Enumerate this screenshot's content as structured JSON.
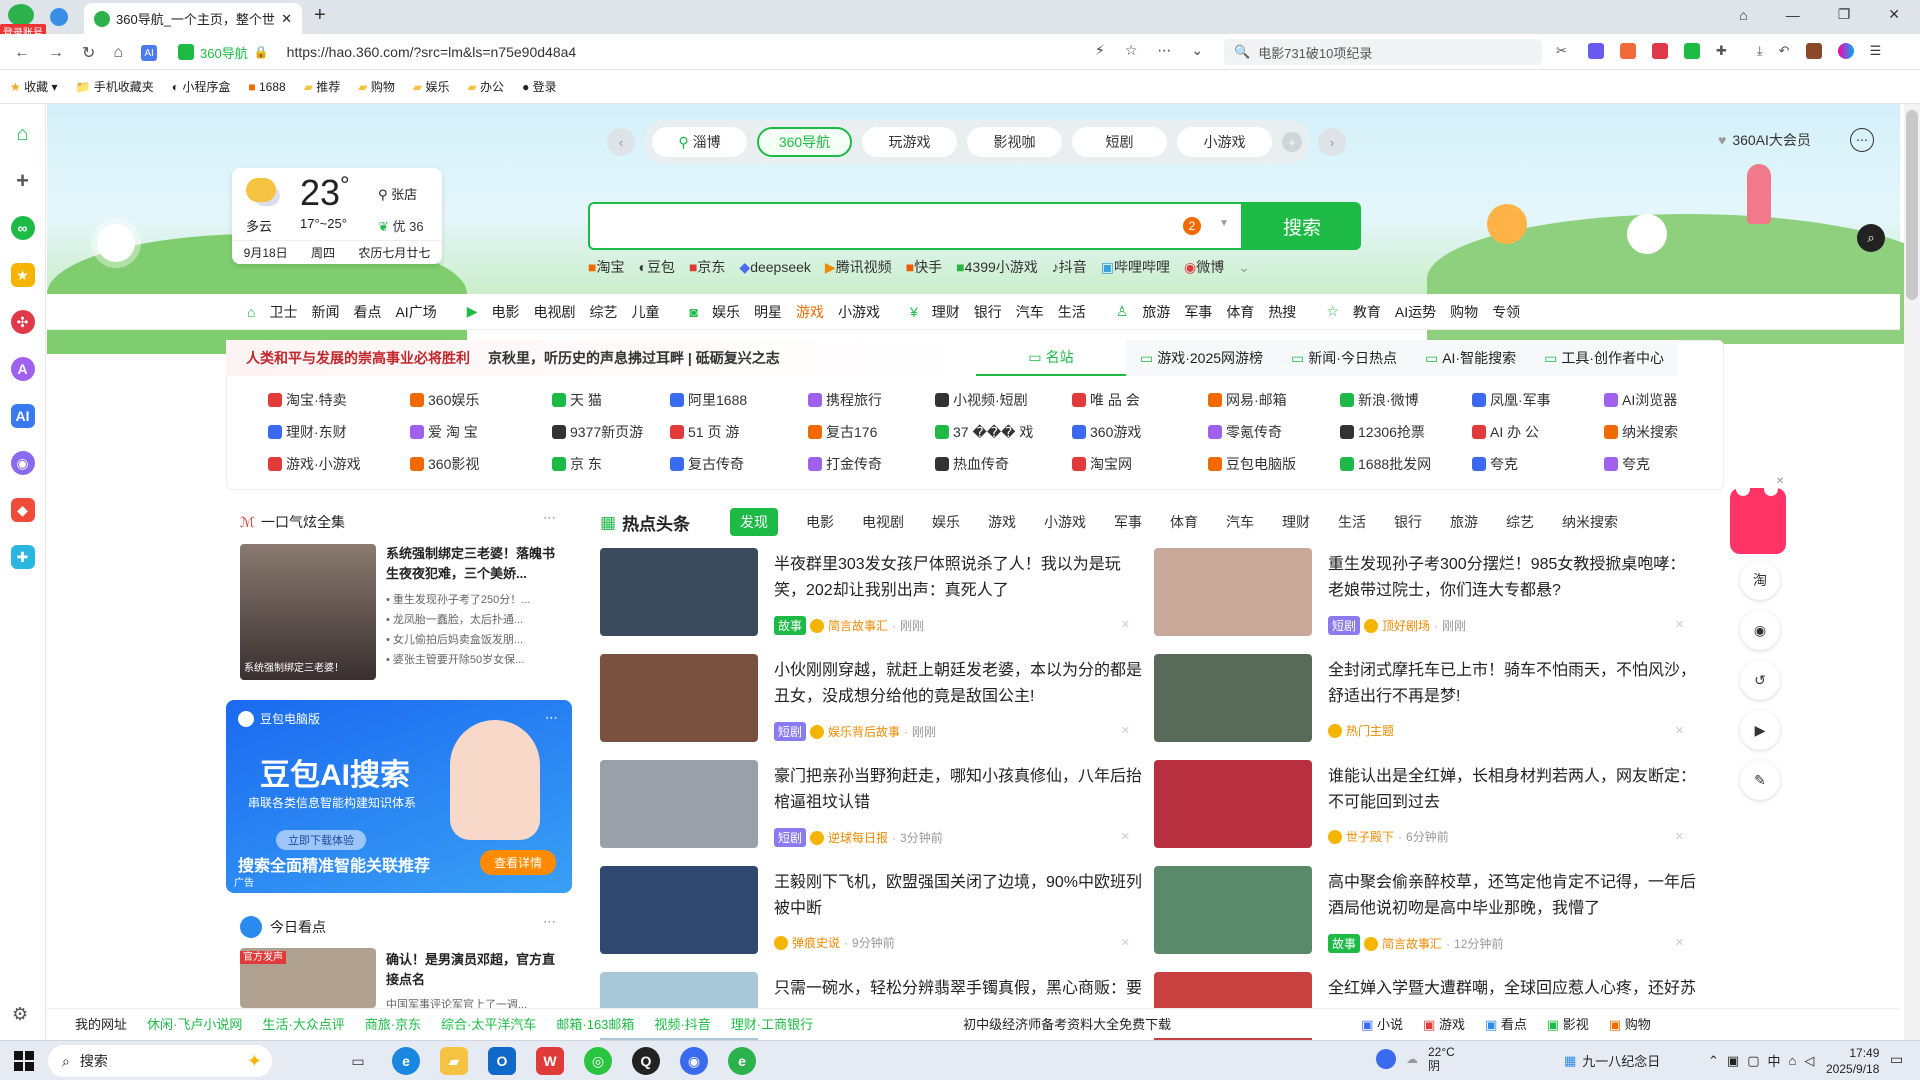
{
  "browser": {
    "badge": "登录账号",
    "tab_title": "360导航_一个主页，整个世界",
    "address": "https://hao.360.com/?src=lm&ls=n75e90d48a4",
    "site_label": "360导航",
    "search_hint": "电影731破10项纪录",
    "bookmarks": [
      "收藏",
      "手机收藏夹",
      "小程序盒",
      "1688",
      "推荐",
      "购物",
      "娱乐",
      "办公",
      "登录"
    ]
  },
  "hero": {
    "channels": [
      "淄博",
      "360导航",
      "玩游戏",
      "影视咖",
      "短剧",
      "小游戏"
    ],
    "member": "360AI大会员",
    "weather": {
      "temp": "23",
      "unit": "°",
      "cond": "多云",
      "range": "17°~25°",
      "city": "张店",
      "aqi": "优 36",
      "date": "9月18日",
      "weekday": "周四",
      "lunar": "农历七月廿七"
    },
    "search_btn": "搜索",
    "search_badge": "2",
    "quicklinks": [
      "淘宝",
      "豆包",
      "京东",
      "deepseek",
      "腾讯视频",
      "快手",
      "4399小游戏",
      "抖音",
      "哔哩哔哩",
      "微博"
    ]
  },
  "catnav": [
    [
      "卫士",
      "新闻",
      "看点",
      "AI广场"
    ],
    [
      "电影",
      "电视剧",
      "综艺",
      "儿童"
    ],
    [
      "娱乐",
      "明星",
      "游戏",
      "小游戏"
    ],
    [
      "理财",
      "银行",
      "汽车",
      "生活"
    ],
    [
      "旅游",
      "军事",
      "体育",
      "热搜"
    ],
    [
      "教育",
      "AI运势",
      "购物",
      "专领"
    ]
  ],
  "headline": {
    "a": "人类和平与发展的崇高事业必将胜利",
    "b": "京秋里，听历史的声息拂过耳畔 | 砥砺复兴之志"
  },
  "sitetabs": [
    "名站",
    "游戏·2025网游榜",
    "新闻·今日热点",
    "AI·智能搜索",
    "工具·创作者中心"
  ],
  "sites": [
    [
      "淘宝·特卖",
      "360娱乐",
      "天 猫",
      "阿里1688",
      "携程旅行",
      "小视频·短剧",
      "唯 品 会",
      "网易·邮箱",
      "新浪·微博",
      "凤凰·军事",
      "AI浏览器"
    ],
    [
      "理财·东财",
      "爱 淘 宝",
      "9377新页游",
      "51 页 游",
      "复古176",
      "37 ��� 戏",
      "360游戏",
      "零氪传奇",
      "12306抢票",
      "AI 办 公",
      "纳米搜索"
    ],
    [
      "游戏·小游戏",
      "360影视",
      "京 东",
      "复古传奇",
      "打金传奇",
      "热血传奇",
      "淘宝网",
      "豆包电脑版",
      "1688批发网",
      "夸克",
      "夸克"
    ]
  ],
  "leftcard": {
    "title": "一口气炫全集",
    "story_title": "系统强制绑定三老婆！落魄书生夜夜犯难，三个美娇...",
    "thumb_caption": "系统强制绑定三老婆！",
    "bullets": [
      "重生发现孙子考了250分！...",
      "龙凤胎一蠢脸，太后扑通...",
      "女儿偷拍后妈卖盒饭发朋...",
      "婆张主管要开除50岁女保..."
    ]
  },
  "ad": {
    "brand": "豆包电脑版",
    "title": "豆包AI搜索",
    "sub": "串联各类信息智能构建知识体系",
    "btn_small": "立即下载体验",
    "tagline": "搜索全面精准智能关联推荐",
    "cta": "查看详情",
    "label": "广告"
  },
  "todaycard": {
    "title": "今日看点",
    "story": "确认！是男演员邓超，官方直接点名",
    "tag": "官方发声",
    "sub": "中国军事评论军官上了一週..."
  },
  "news": {
    "title": "热点头条",
    "tabs": [
      "发现",
      "电影",
      "电视剧",
      "娱乐",
      "游戏",
      "小游戏",
      "军事",
      "体育",
      "汽车",
      "理财",
      "生活",
      "银行",
      "旅游",
      "综艺",
      "纳米搜索"
    ],
    "items": [
      {
        "title": "半夜群里303发女孩尸体照说杀了人！我以为是玩笑，202却让我别出声：真死人了",
        "tag": "故事",
        "tagc": "#1dbb46",
        "src": "简言故事汇",
        "time": "刚刚",
        "thumb": "#3a4a5a"
      },
      {
        "title": "重生发现孙子考300分摆烂！985女教授掀桌咆哮：老娘带过院士，你们连大专都悬?",
        "tag": "短剧",
        "tagc": "#8a7cf0",
        "src": "顶好剧场",
        "time": "刚刚",
        "thumb": "#c8a898"
      },
      {
        "title": "小伙刚刚穿越，就赶上朝廷发老婆，本以为分的都是丑女，没成想分给他的竟是敌国公主!",
        "tag": "短剧",
        "tagc": "#8a7cf0",
        "src": "娱乐背后故事",
        "time": "刚刚",
        "thumb": "#7a5040"
      },
      {
        "title": "全封闭式摩托车已上市！骑车不怕雨天，不怕风沙，舒适出行不再是梦!",
        "tag": "",
        "tagc": "",
        "src": "热门主题",
        "time": "",
        "thumb": "#5a6a5a"
      },
      {
        "title": "豪门把亲孙当野狗赶走，哪知小孩真修仙，八年后抬棺逼祖坟认错",
        "tag": "短剧",
        "tagc": "#8a7cf0",
        "src": "逆球每日报",
        "time": "3分钟前",
        "thumb": "#9aa0a8"
      },
      {
        "title": "谁能认出是全红婵，长相身材判若两人，网友断定：不可能回到过去",
        "tag": "",
        "tagc": "",
        "src": "世子殿下",
        "time": "6分钟前",
        "thumb": "#b83040"
      },
      {
        "title": "王毅刚下飞机，欧盟强国关闭了边境，90%中欧班列被中断",
        "tag": "",
        "tagc": "",
        "src": "弹痕史说",
        "time": "9分钟前",
        "thumb": "#304870"
      },
      {
        "title": "高中聚会偷亲醉校草，还笃定他肯定不记得，一年后酒局他说初吻是高中毕业那晚，我懵了",
        "tag": "故事",
        "tagc": "#1dbb46",
        "src": "简言故事汇",
        "time": "12分钟前",
        "thumb": "#5a8a6a"
      },
      {
        "title": "只需一碗水，轻松分辨翡翠手镯真假，黑心商贩：要",
        "tag": "",
        "tagc": "",
        "src": "",
        "time": "",
        "thumb": "#a8c8d8"
      },
      {
        "title": "全红婵入学暨大遭群嘲，全球回应惹人心疼，还好苏",
        "tag": "",
        "tagc": "",
        "src": "",
        "time": "",
        "thumb": "#c84040"
      }
    ]
  },
  "rightbar": [
    "淘",
    "◉",
    "↺",
    "▶",
    "✎"
  ],
  "bottom": {
    "items": [
      "我的网址",
      "休闲·飞卢小说网",
      "生活·大众点评",
      "商旅·京东",
      "综合·太平洋汽车",
      "邮箱·163邮箱",
      "视频·抖音",
      "理财·工商银行"
    ],
    "promo": "初中级经济师备考资料大全免费下载",
    "right": [
      "小说",
      "游戏",
      "看点",
      "影视",
      "购物"
    ]
  },
  "taskbar": {
    "search": "搜索",
    "temp": "22°C",
    "weather": "阴",
    "notice": "九一八纪念日",
    "ime": "中",
    "time": "17:49",
    "date": "2025/9/18"
  },
  "colors": {
    "green": "#1dbb46",
    "orange": "#f08a00"
  }
}
